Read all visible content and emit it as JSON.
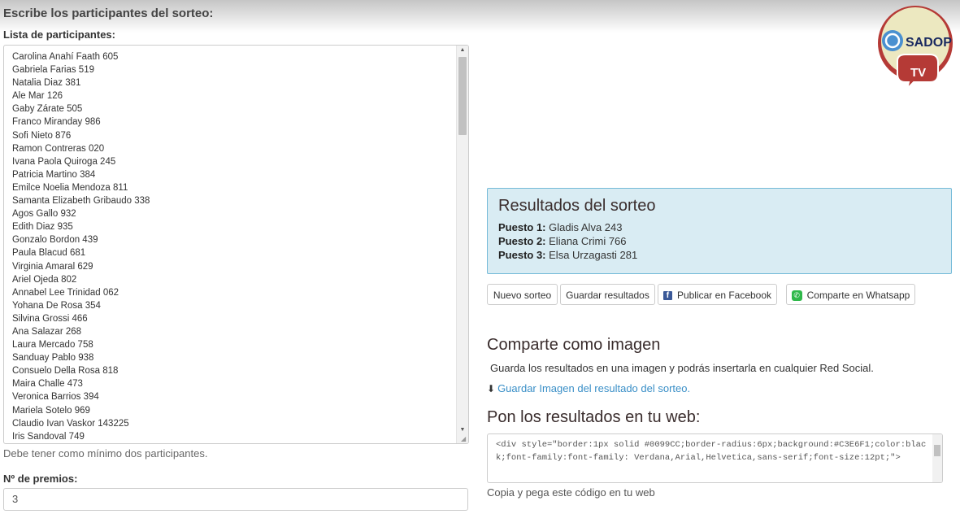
{
  "form": {
    "heading": "Escribe los participantes del sorteo:",
    "list_label": "Lista de participantes:",
    "participants": [
      "Carolina Anahí Faath 605",
      "Gabriela Farias 519",
      "Natalia Diaz 381",
      "Ale Mar 126",
      "Gaby Zárate 505",
      "Franco Miranday 986",
      "Sofi Nieto 876",
      "Ramon Contreras 020",
      "Ivana Paola Quiroga 245",
      "Patricia Martino 384",
      "Emilce Noelia Mendoza 811",
      "Samanta Elizabeth Gribaudo 338",
      "Agos Gallo 932",
      "Edith Diaz 935",
      "Gonzalo Bordon 439",
      "Paula Blacud 681",
      "Virginia Amaral 629",
      "Ariel Ojeda  802",
      "Annabel Lee Trinidad 062",
      "Yohana De Rosa 354",
      "Silvina Grossi 466",
      "Ana Salazar 268",
      "Laura Mercado 758",
      "Sanduay Pablo 938",
      "Consuelo Della Rosa 818",
      "Maira Challe 473",
      "Veronica Barrios 394",
      "Mariela Sotelo 969",
      "Claudio Ivan Vaskor 143225",
      "Iris Sandoval 749"
    ],
    "min_hint": "Debe tener como mínimo dos participantes.",
    "prizes_label": "Nº de premios:",
    "prizes_value": "3"
  },
  "results": {
    "title": "Resultados del sorteo",
    "rows": [
      {
        "label": "Puesto 1:",
        "value": "Gladis Alva 243"
      },
      {
        "label": "Puesto 2:",
        "value": "Eliana Crimi 766"
      },
      {
        "label": "Puesto 3:",
        "value": "Elsa Urzagasti 281"
      }
    ]
  },
  "actions": {
    "new_draw": "Nuevo sorteo",
    "save_results": "Guardar resultados",
    "facebook": "Publicar en Facebook",
    "whatsapp": "Comparte en Whatsapp"
  },
  "share_image": {
    "title": "Comparte como imagen",
    "text": "Guarda los resultados en una imagen y podrás insertarla en cualquier Red Social.",
    "link": "Guardar Imagen del resultado del sorteo."
  },
  "embed": {
    "title": "Pon los resultados en tu web:",
    "code": "<div style=\"border:1px solid #0099CC;border-radius:6px;background:#C3E6F1;color:black;font-family:font-family: Verdana,Arial,Helvetica,sans-serif;font-size:12pt;\">",
    "hint": "Copia y pega este código en tu web"
  },
  "logo": {
    "text": "SADOP",
    "badge": "TV"
  },
  "colors": {
    "results_bg": "#d9ecf3",
    "results_border": "#74bad8",
    "link": "#3a8fc7",
    "facebook": "#3b5998",
    "whatsapp": "#2fb84a",
    "logo_red": "#b53a36"
  },
  "icons": {
    "download": "download-icon",
    "facebook": "facebook-icon",
    "whatsapp": "whatsapp-icon"
  }
}
